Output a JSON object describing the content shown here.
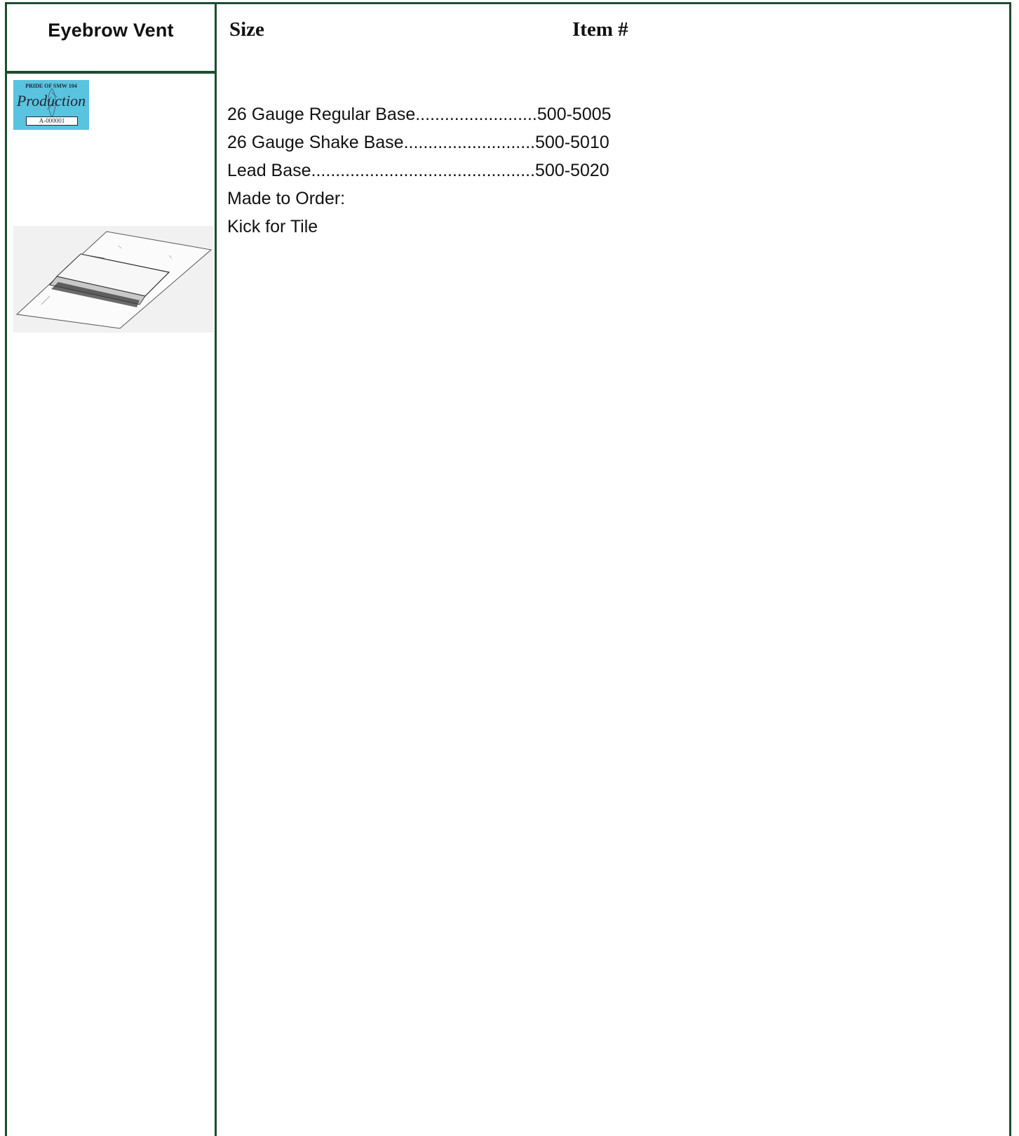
{
  "product": {
    "title": "Eyebrow Vent"
  },
  "badge": {
    "top_text": "PRIDE OF SMW 104",
    "script_text": "Production",
    "serial": "A-000001",
    "background_color": "#5ac3df"
  },
  "columns": {
    "size": "Size",
    "item": "Item #"
  },
  "items": [
    "26 Gauge Regular Base.........................500-5005",
    "26 Gauge Shake Base...........................500-5010",
    "Lead Base..............................................500-5020",
    "Made to Order:",
    "Kick for Tile"
  ],
  "colors": {
    "border": "#1e4d30"
  }
}
